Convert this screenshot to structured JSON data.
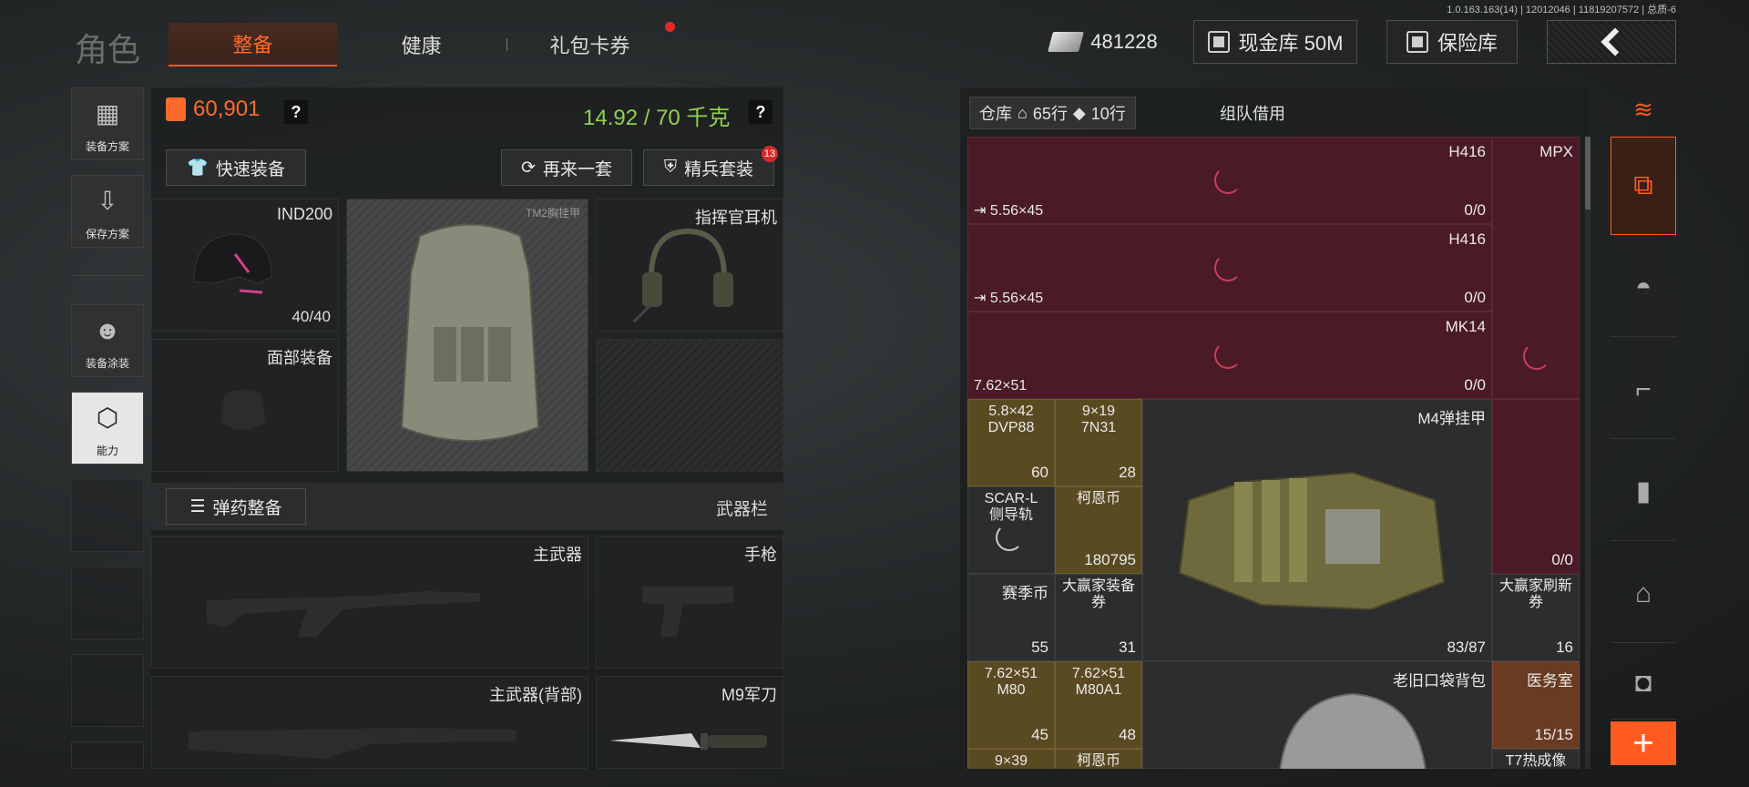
{
  "version": "1.0.163.163(14) | 12012046 | 11819207572 | 总质-6",
  "header": {
    "title": "角色",
    "tabs": [
      {
        "label": "整备"
      },
      {
        "label": "健康"
      },
      {
        "label": "礼包卡券"
      }
    ],
    "money": "481228",
    "cash_vault": "现金库 50M",
    "safe": "保险库"
  },
  "sidebar": {
    "items": [
      {
        "label": "装备方案",
        "icon": "vest-icon"
      },
      {
        "label": "保存方案",
        "icon": "download-icon"
      },
      {
        "label": "装备涂装",
        "icon": "paint-icon"
      },
      {
        "label": "能力",
        "icon": "ability-icon"
      }
    ]
  },
  "loadout": {
    "value": "60,901",
    "weight": "14.92 / 70 千克",
    "quick_equip": "快速装备",
    "again": "再来一套",
    "elite": "精兵套装",
    "elite_badge": "13",
    "helmet": {
      "name": "IND200",
      "durability": "40/40"
    },
    "armor": {
      "name": "TM2胸挂甲"
    },
    "headset": {
      "name": "指挥官耳机"
    },
    "face": {
      "name": "面部装备"
    },
    "ammo_btn": "弹药整备",
    "weapon_bar": "武器栏",
    "primary": "主武器",
    "pistol": "手枪",
    "primary_back": "主武器(背部)",
    "melee": "M9军刀"
  },
  "stash": {
    "tab_label": "仓库",
    "rows": "65行",
    "tickets": "10行",
    "team_borrow": "组队借用",
    "cells": {
      "h416_1": {
        "name": "H416",
        "ammo": "5.56×45",
        "count": "0/0"
      },
      "mpx": {
        "name": "MPX"
      },
      "h416_2": {
        "name": "H416",
        "ammo": "5.56×45",
        "count": "0/0"
      },
      "mk14": {
        "name": "MK14",
        "ammo": "7.62×51",
        "count": "0/0"
      },
      "right_red": {
        "count": "0/0"
      },
      "dvp88": {
        "name": "5.8×42\nDVP88",
        "qty": "60"
      },
      "7n31": {
        "name": "9×19\n7N31",
        "qty": "28"
      },
      "m4": {
        "name": "M4弹挂甲",
        "durability": "83/87"
      },
      "scar": {
        "name": "SCAR-L\n侧导轨"
      },
      "coin": {
        "name": "柯恩币",
        "qty": "180795"
      },
      "season": {
        "name": "赛季币",
        "qty": "55"
      },
      "winner_equip": {
        "name": "大赢家装备券",
        "qty": "31"
      },
      "winner_refresh": {
        "name": "大赢家刷新券",
        "qty": "16"
      },
      "m80": {
        "name": "7.62×51\nM80",
        "qty": "45"
      },
      "m80a1": {
        "name": "7.62×51\nM80A1",
        "qty": "48"
      },
      "backpack": {
        "name": "老旧口袋背包"
      },
      "medical": {
        "name": "医务室",
        "qty": "15/15"
      },
      "bottom1": {
        "name": "9×39"
      },
      "bottom2": {
        "name": "柯恩币"
      },
      "bottom3": {
        "name": "T7热成像"
      }
    }
  },
  "colors": {
    "accent": "#ff5a1f",
    "green": "#8fd14f",
    "red_slot": "#4a1a26",
    "gold_slot": "#5a4a22"
  }
}
